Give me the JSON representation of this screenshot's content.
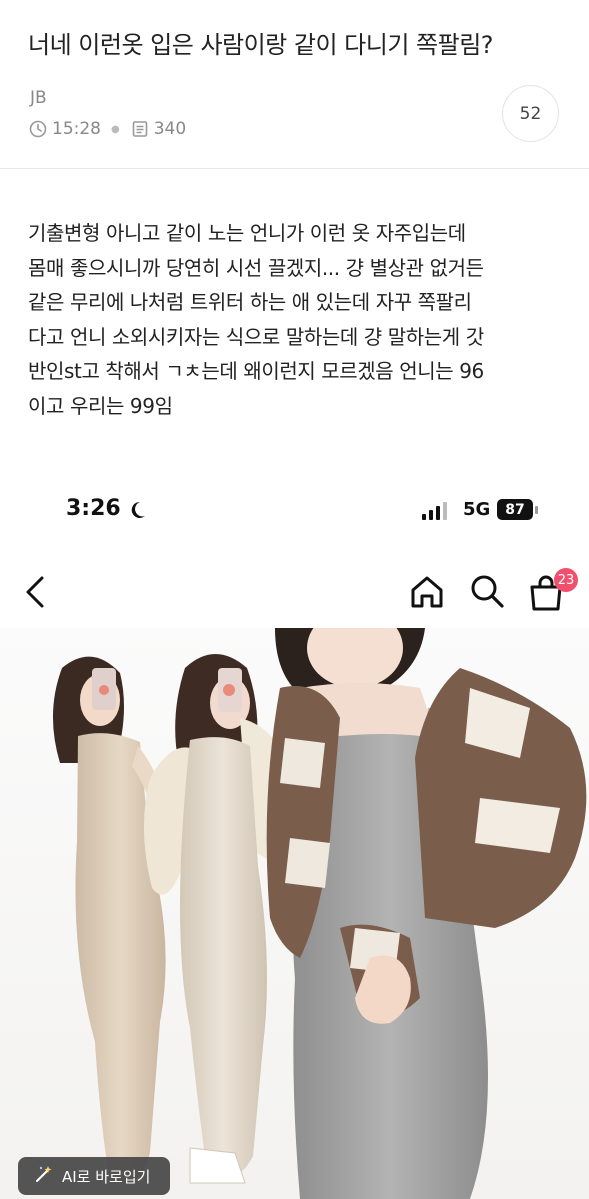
{
  "post": {
    "title": "너네 이런옷 입은 사람이랑 같이 다니기 쪽팔림?",
    "author": "JB",
    "time": "15:28",
    "views": "340",
    "comment_count": "52",
    "body_lines": [
      "기출변형 아니고 같이 노는 언니가 이런 옷 자주입는데",
      "몸매 좋으시니까 당연히 시선 끌겠지... 걍 별상관 없거든",
      "같은 무리에 나처럼 트위터 하는 애 있는데 자꾸 쪽팔리",
      "다고 언니 소외시키자는 식으로 말하는데 걍 말하는게 갓",
      "반인st고 착해서 ㄱㅊ는데 왜이런지 모르겠음 언니는 96",
      "이고 우리는 99임"
    ]
  },
  "screenshot": {
    "status_time": "3:26",
    "network": "5G",
    "battery": "87",
    "cart_badge": "23",
    "ai_button": "AI로 바로입기"
  },
  "icons": [
    "clock-icon",
    "list-icon",
    "moon-icon",
    "signal-icon",
    "battery-icon",
    "back-arrow-icon",
    "home-icon",
    "search-icon",
    "shopping-bag-icon",
    "magic-wand-icon"
  ],
  "colors": {
    "accent_badge": "#f0506e",
    "muted_text": "#888888"
  }
}
